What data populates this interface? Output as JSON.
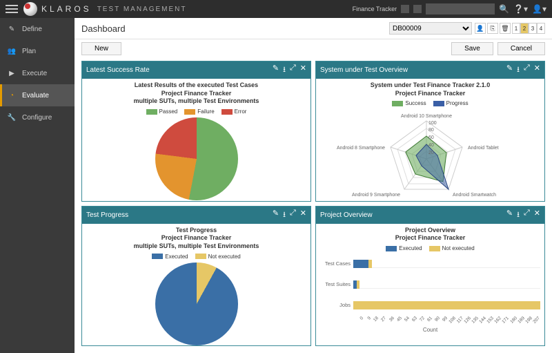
{
  "brand": {
    "name": "KLAROS",
    "sub": "TEST MANAGEMENT"
  },
  "topbar": {
    "project_label": "Finance Tracker",
    "search_placeholder": ""
  },
  "sidebar": {
    "items": [
      {
        "label": "Define",
        "icon": "pencil"
      },
      {
        "label": "Plan",
        "icon": "users"
      },
      {
        "label": "Execute",
        "icon": "play"
      },
      {
        "label": "Evaluate",
        "icon": "pie",
        "active": true
      },
      {
        "label": "Configure",
        "icon": "wrench"
      }
    ]
  },
  "page": {
    "title": "Dashboard",
    "selector_value": "DB00009",
    "pager": {
      "prev": "1",
      "current": "2",
      "next": "3",
      "last": "4"
    },
    "new_btn": "New",
    "save_btn": "Save",
    "cancel_btn": "Cancel"
  },
  "panels": {
    "latest_success": {
      "title": "Latest Success Rate",
      "chart_title_1": "Latest Results of the executed Test Cases",
      "chart_title_2": "Project Finance Tracker",
      "chart_title_3": "multiple SUTs, multiple Test Environments",
      "legend": {
        "passed": "Passed",
        "failure": "Failure",
        "error": "Error"
      }
    },
    "sut_overview": {
      "title": "System under Test Overview",
      "chart_title_1": "System under Test Finance Tracker 2.1.0",
      "chart_title_2": "Project Finance Tracker",
      "legend": {
        "success": "Success",
        "progress": "Progress"
      },
      "axes": [
        "Android 10 Smartphone",
        "Android Tablet",
        "Android Smartwatch",
        "Android 9 Smartphone",
        "Android 8 Smartphone"
      ],
      "rings": [
        "100",
        "80",
        "60",
        "40",
        "20"
      ]
    },
    "test_progress": {
      "title": "Test Progress",
      "chart_title_1": "Test Progress",
      "chart_title_2": "Project Finance Tracker",
      "chart_title_3": "multiple SUTs, multiple Test Environments",
      "legend": {
        "executed": "Executed",
        "not_executed": "Not executed"
      }
    },
    "project_overview": {
      "title": "Project Overview",
      "chart_title_1": "Project Overview",
      "chart_title_2": "Project Finance Tracker",
      "legend": {
        "executed": "Executed",
        "not_executed": "Not executed"
      },
      "rows": {
        "test_cases": "Test Cases",
        "test_suites": "Test Suites",
        "jobs": "Jobs"
      },
      "xlabel": "Count",
      "ticks": [
        "0",
        "9",
        "18",
        "27",
        "36",
        "45",
        "54",
        "63",
        "72",
        "81",
        "90",
        "99",
        "108",
        "117",
        "126",
        "135",
        "144",
        "153",
        "162",
        "171",
        "180",
        "189",
        "198",
        "207"
      ]
    }
  },
  "chart_data": [
    {
      "type": "pie",
      "id": "latest_success_rate",
      "title": "Latest Results of the executed Test Cases — Project Finance Tracker — multiple SUTs, multiple Test Environments",
      "series": [
        {
          "name": "Passed",
          "value": 53,
          "color": "#6fae62"
        },
        {
          "name": "Failure",
          "value": 24,
          "color": "#e3942e"
        },
        {
          "name": "Error",
          "value": 23,
          "color": "#cf4b3e"
        }
      ]
    },
    {
      "type": "radar",
      "id": "sut_overview",
      "title": "System under Test Finance Tracker 2.1.0 — Project Finance Tracker",
      "categories": [
        "Android 10 Smartphone",
        "Android Tablet",
        "Android Smartwatch",
        "Android 9 Smartphone",
        "Android 8 Smartphone"
      ],
      "max": 100,
      "rings": [
        20,
        40,
        60,
        80,
        100
      ],
      "series": [
        {
          "name": "Success",
          "color": "#6fae62",
          "values": [
            60,
            55,
            75,
            48,
            58
          ]
        },
        {
          "name": "Progress",
          "color": "#3a5fa6",
          "values": [
            38,
            30,
            100,
            22,
            28
          ]
        }
      ]
    },
    {
      "type": "pie",
      "id": "test_progress",
      "title": "Test Progress — Project Finance Tracker — multiple SUTs, multiple Test Environments",
      "series": [
        {
          "name": "Executed",
          "value": 92,
          "color": "#3a6fa6"
        },
        {
          "name": "Not executed",
          "value": 8,
          "color": "#e6c766"
        }
      ]
    },
    {
      "type": "bar",
      "orientation": "horizontal",
      "id": "project_overview",
      "title": "Project Overview — Project Finance Tracker",
      "xlabel": "Count",
      "xlim": [
        0,
        207
      ],
      "categories": [
        "Test Cases",
        "Test Suites",
        "Jobs"
      ],
      "series": [
        {
          "name": "Executed",
          "color": "#3a6fa6",
          "values": [
            17,
            4,
            0
          ]
        },
        {
          "name": "Not executed",
          "color": "#e6c766",
          "values": [
            4,
            3,
            207
          ]
        }
      ]
    }
  ]
}
